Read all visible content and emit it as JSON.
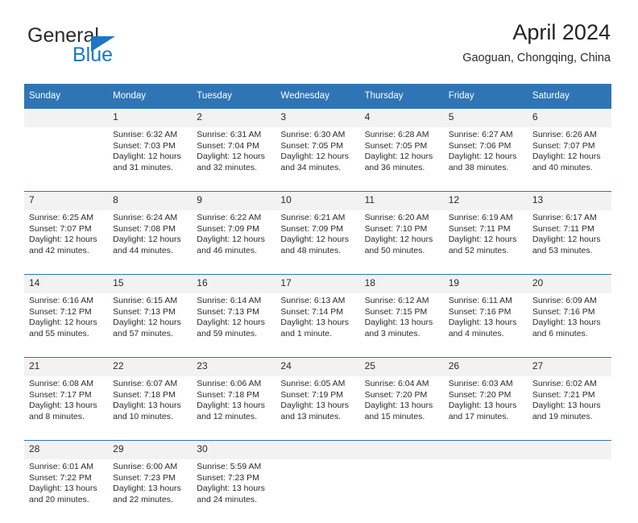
{
  "brand": {
    "name_part1": "General",
    "name_part2": "Blue",
    "triangle_icon": "triangle-icon",
    "accent_color": "#1c76c4"
  },
  "header": {
    "title": "April 2024",
    "location": "Gaoguan, Chongqing, China"
  },
  "theme": {
    "header_blue": "#2f75b5",
    "daynum_gray": "#f2f2f2",
    "text": "#2b2b2b"
  },
  "calendar": {
    "weekday_headers": [
      "Sunday",
      "Monday",
      "Tuesday",
      "Wednesday",
      "Thursday",
      "Friday",
      "Saturday"
    ],
    "weeks": [
      [
        {
          "date": "",
          "lines": []
        },
        {
          "date": "1",
          "lines": [
            "Sunrise: 6:32 AM",
            "Sunset: 7:03 PM",
            "Daylight: 12 hours",
            "and 31 minutes."
          ]
        },
        {
          "date": "2",
          "lines": [
            "Sunrise: 6:31 AM",
            "Sunset: 7:04 PM",
            "Daylight: 12 hours",
            "and 32 minutes."
          ]
        },
        {
          "date": "3",
          "lines": [
            "Sunrise: 6:30 AM",
            "Sunset: 7:05 PM",
            "Daylight: 12 hours",
            "and 34 minutes."
          ]
        },
        {
          "date": "4",
          "lines": [
            "Sunrise: 6:28 AM",
            "Sunset: 7:05 PM",
            "Daylight: 12 hours",
            "and 36 minutes."
          ]
        },
        {
          "date": "5",
          "lines": [
            "Sunrise: 6:27 AM",
            "Sunset: 7:06 PM",
            "Daylight: 12 hours",
            "and 38 minutes."
          ]
        },
        {
          "date": "6",
          "lines": [
            "Sunrise: 6:26 AM",
            "Sunset: 7:07 PM",
            "Daylight: 12 hours",
            "and 40 minutes."
          ]
        }
      ],
      [
        {
          "date": "7",
          "lines": [
            "Sunrise: 6:25 AM",
            "Sunset: 7:07 PM",
            "Daylight: 12 hours",
            "and 42 minutes."
          ]
        },
        {
          "date": "8",
          "lines": [
            "Sunrise: 6:24 AM",
            "Sunset: 7:08 PM",
            "Daylight: 12 hours",
            "and 44 minutes."
          ]
        },
        {
          "date": "9",
          "lines": [
            "Sunrise: 6:22 AM",
            "Sunset: 7:09 PM",
            "Daylight: 12 hours",
            "and 46 minutes."
          ]
        },
        {
          "date": "10",
          "lines": [
            "Sunrise: 6:21 AM",
            "Sunset: 7:09 PM",
            "Daylight: 12 hours",
            "and 48 minutes."
          ]
        },
        {
          "date": "11",
          "lines": [
            "Sunrise: 6:20 AM",
            "Sunset: 7:10 PM",
            "Daylight: 12 hours",
            "and 50 minutes."
          ]
        },
        {
          "date": "12",
          "lines": [
            "Sunrise: 6:19 AM",
            "Sunset: 7:11 PM",
            "Daylight: 12 hours",
            "and 52 minutes."
          ]
        },
        {
          "date": "13",
          "lines": [
            "Sunrise: 6:17 AM",
            "Sunset: 7:11 PM",
            "Daylight: 12 hours",
            "and 53 minutes."
          ]
        }
      ],
      [
        {
          "date": "14",
          "lines": [
            "Sunrise: 6:16 AM",
            "Sunset: 7:12 PM",
            "Daylight: 12 hours",
            "and 55 minutes."
          ]
        },
        {
          "date": "15",
          "lines": [
            "Sunrise: 6:15 AM",
            "Sunset: 7:13 PM",
            "Daylight: 12 hours",
            "and 57 minutes."
          ]
        },
        {
          "date": "16",
          "lines": [
            "Sunrise: 6:14 AM",
            "Sunset: 7:13 PM",
            "Daylight: 12 hours",
            "and 59 minutes."
          ]
        },
        {
          "date": "17",
          "lines": [
            "Sunrise: 6:13 AM",
            "Sunset: 7:14 PM",
            "Daylight: 13 hours",
            "and 1 minute."
          ]
        },
        {
          "date": "18",
          "lines": [
            "Sunrise: 6:12 AM",
            "Sunset: 7:15 PM",
            "Daylight: 13 hours",
            "and 3 minutes."
          ]
        },
        {
          "date": "19",
          "lines": [
            "Sunrise: 6:11 AM",
            "Sunset: 7:16 PM",
            "Daylight: 13 hours",
            "and 4 minutes."
          ]
        },
        {
          "date": "20",
          "lines": [
            "Sunrise: 6:09 AM",
            "Sunset: 7:16 PM",
            "Daylight: 13 hours",
            "and 6 minutes."
          ]
        }
      ],
      [
        {
          "date": "21",
          "lines": [
            "Sunrise: 6:08 AM",
            "Sunset: 7:17 PM",
            "Daylight: 13 hours",
            "and 8 minutes."
          ]
        },
        {
          "date": "22",
          "lines": [
            "Sunrise: 6:07 AM",
            "Sunset: 7:18 PM",
            "Daylight: 13 hours",
            "and 10 minutes."
          ]
        },
        {
          "date": "23",
          "lines": [
            "Sunrise: 6:06 AM",
            "Sunset: 7:18 PM",
            "Daylight: 13 hours",
            "and 12 minutes."
          ]
        },
        {
          "date": "24",
          "lines": [
            "Sunrise: 6:05 AM",
            "Sunset: 7:19 PM",
            "Daylight: 13 hours",
            "and 13 minutes."
          ]
        },
        {
          "date": "25",
          "lines": [
            "Sunrise: 6:04 AM",
            "Sunset: 7:20 PM",
            "Daylight: 13 hours",
            "and 15 minutes."
          ]
        },
        {
          "date": "26",
          "lines": [
            "Sunrise: 6:03 AM",
            "Sunset: 7:20 PM",
            "Daylight: 13 hours",
            "and 17 minutes."
          ]
        },
        {
          "date": "27",
          "lines": [
            "Sunrise: 6:02 AM",
            "Sunset: 7:21 PM",
            "Daylight: 13 hours",
            "and 19 minutes."
          ]
        }
      ],
      [
        {
          "date": "28",
          "lines": [
            "Sunrise: 6:01 AM",
            "Sunset: 7:22 PM",
            "Daylight: 13 hours",
            "and 20 minutes."
          ]
        },
        {
          "date": "29",
          "lines": [
            "Sunrise: 6:00 AM",
            "Sunset: 7:23 PM",
            "Daylight: 13 hours",
            "and 22 minutes."
          ]
        },
        {
          "date": "30",
          "lines": [
            "Sunrise: 5:59 AM",
            "Sunset: 7:23 PM",
            "Daylight: 13 hours",
            "and 24 minutes."
          ]
        },
        {
          "date": "",
          "lines": []
        },
        {
          "date": "",
          "lines": []
        },
        {
          "date": "",
          "lines": []
        },
        {
          "date": "",
          "lines": []
        }
      ]
    ]
  }
}
